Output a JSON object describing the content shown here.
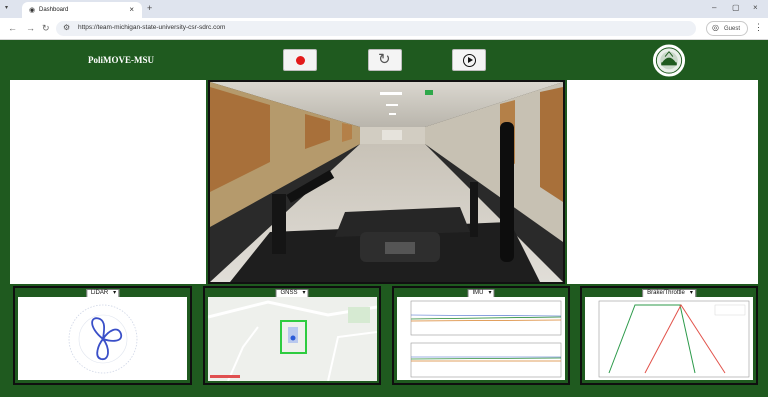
{
  "browser": {
    "tab_title": "Dashboard",
    "tab_favicon": "globe-icon",
    "url": "https://team-michigan-state-university-csr-sdrc.com",
    "guest_label": "Guest"
  },
  "app": {
    "brand": "PoliMOVE-MSU",
    "controls": {
      "record": "record-button",
      "reset": "reset-button",
      "play": "play-button"
    },
    "colors": {
      "header": "#1f5a1f",
      "record": "#e31b1b",
      "border": "#0f0f0f"
    }
  },
  "panels": [
    {
      "selected": "LiDAR",
      "kind": "lidar-plot"
    },
    {
      "selected": "GNSS",
      "kind": "map-view"
    },
    {
      "selected": "IMU",
      "kind": "imu-plots"
    },
    {
      "selected": "Brake/Throttle",
      "kind": "brake-throttle-plot"
    }
  ]
}
